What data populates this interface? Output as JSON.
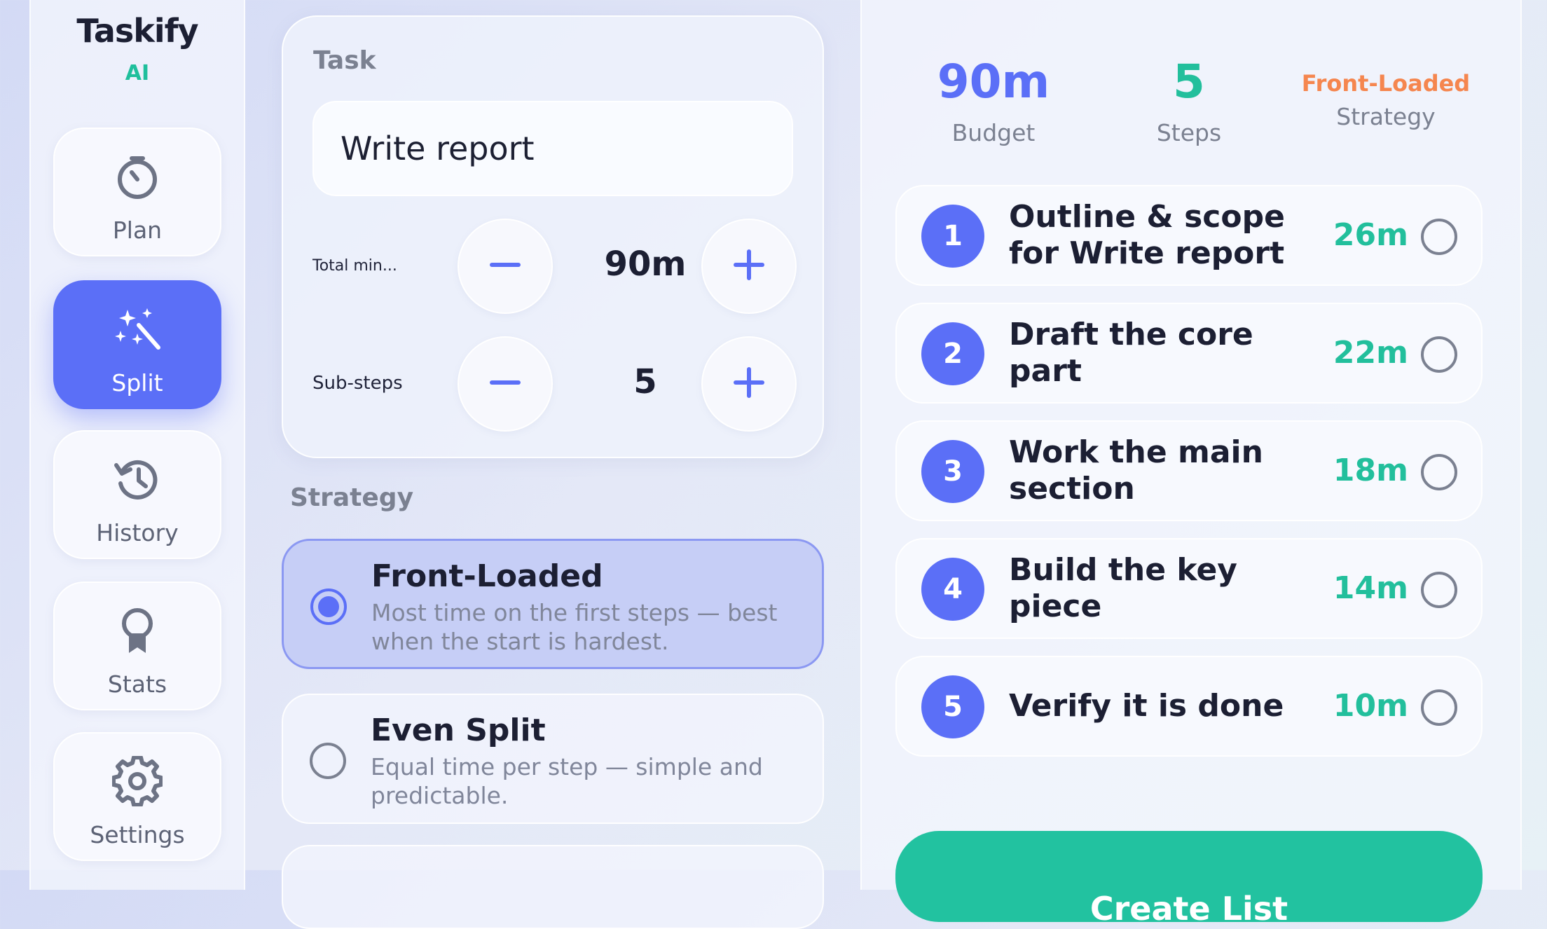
{
  "brand": {
    "title": "Taskify",
    "subtitle": "AI"
  },
  "sidebar": {
    "items": [
      {
        "label": "Plan",
        "icon": "timer-icon",
        "active": false
      },
      {
        "label": "Split",
        "icon": "magic-wand-icon",
        "active": true
      },
      {
        "label": "History",
        "icon": "history-icon",
        "active": false
      },
      {
        "label": "Stats",
        "icon": "award-icon",
        "active": false
      },
      {
        "label": "Settings",
        "icon": "gear-icon",
        "active": false
      }
    ]
  },
  "task": {
    "label": "Task",
    "value": "Write report",
    "total_minutes_label": "Total min...",
    "total_minutes_value": "90m",
    "substeps_label": "Sub-steps",
    "substeps_value": "5"
  },
  "strategy": {
    "heading": "Strategy",
    "options": [
      {
        "title": "Front-Loaded",
        "description": "Most time on the first steps — best when the start is hardest.",
        "selected": true
      },
      {
        "title": "Even Split",
        "description": "Equal time per step — simple and predictable.",
        "selected": false
      }
    ]
  },
  "summary": {
    "budget_value": "90m",
    "budget_label": "Budget",
    "steps_value": "5",
    "steps_label": "Steps",
    "strategy_value": "Front-Loaded",
    "strategy_label": "Strategy"
  },
  "steps": [
    {
      "number": "1",
      "title": "Outline & scope for Write report",
      "minutes": "26m"
    },
    {
      "number": "2",
      "title": "Draft the core part",
      "minutes": "22m"
    },
    {
      "number": "3",
      "title": "Work the main section",
      "minutes": "18m"
    },
    {
      "number": "4",
      "title": "Build the key piece",
      "minutes": "14m"
    },
    {
      "number": "5",
      "title": "Verify it is done",
      "minutes": "10m"
    }
  ],
  "cta_label": "Create List",
  "colors": {
    "accent": "#5b6ff7",
    "green": "#22c2a0",
    "orange": "#f5864f",
    "muted": "#7b8191"
  }
}
